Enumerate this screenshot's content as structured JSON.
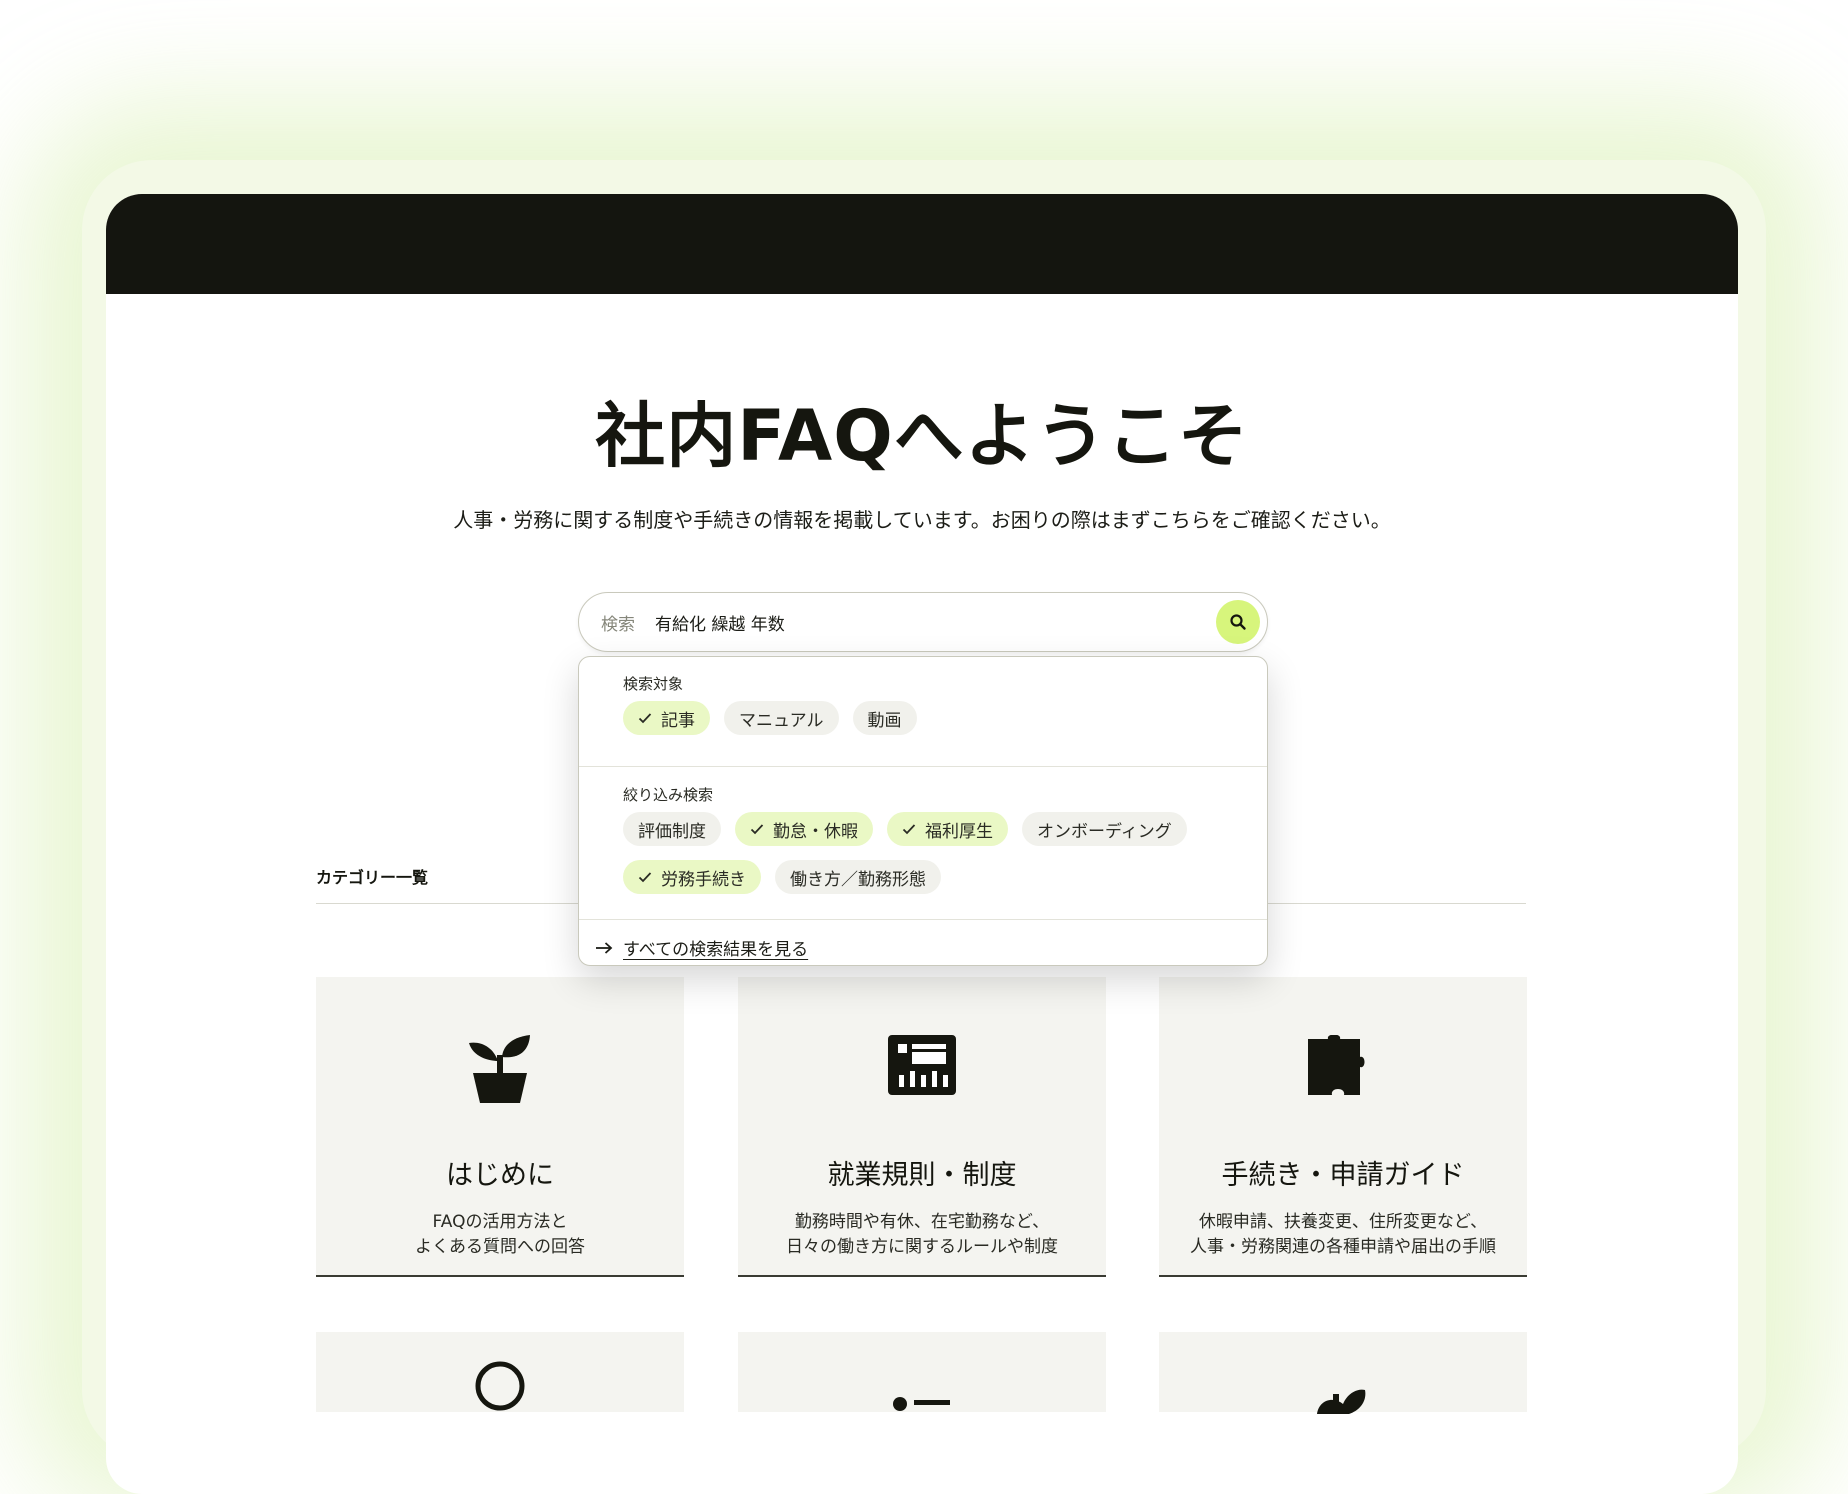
{
  "page": {
    "title": "社内FAQへようこそ",
    "subtitle": "人事・労務に関する制度や手続きの情報を掲載しています。お困りの際はまずこちらをご確認ください。"
  },
  "search": {
    "label": "検索",
    "value": "有給化 繰越 年数",
    "button_icon": "search-icon"
  },
  "dropdown": {
    "target_label": "検索対象",
    "targets": [
      {
        "label": "記事",
        "selected": true
      },
      {
        "label": "マニュアル",
        "selected": false
      },
      {
        "label": "動画",
        "selected": false
      }
    ],
    "filter_label": "絞り込み検索",
    "filters_row1": [
      {
        "label": "評価制度",
        "selected": false
      },
      {
        "label": "勤怠・休暇",
        "selected": true
      },
      {
        "label": "福利厚生",
        "selected": true
      },
      {
        "label": "オンボーディング",
        "selected": false
      }
    ],
    "filters_row2": [
      {
        "label": "労務手続き",
        "selected": true
      },
      {
        "label": "働き方／勤務形態",
        "selected": false
      }
    ],
    "see_all": "すべての検索結果を見る"
  },
  "categories": {
    "heading": "カテゴリー一覧",
    "items": [
      {
        "title": "はじめに",
        "desc": [
          "FAQの活用方法と",
          "よくある質問への回答"
        ],
        "icon": "plant-icon"
      },
      {
        "title": "就業規則・制度",
        "desc": [
          "勤務時間や有休、在宅勤務など、",
          "日々の働き方に関するルールや制度"
        ],
        "icon": "rules-board-icon"
      },
      {
        "title": "手続き・申請ガイド",
        "desc": [
          "休暇申請、扶養変更、住所変更など、",
          "人事・労務関連の各種申請や届出の手順"
        ],
        "icon": "puzzle-icon"
      },
      {
        "icon": "person-icon"
      },
      {
        "icon": "list-icon"
      },
      {
        "icon": "plant-sprout-icon"
      }
    ]
  },
  "colors": {
    "accent": "#d7f57c",
    "chip_selected": "#eaf8c5",
    "topbar": "#14150f",
    "card_bg": "#f4f4f0"
  }
}
